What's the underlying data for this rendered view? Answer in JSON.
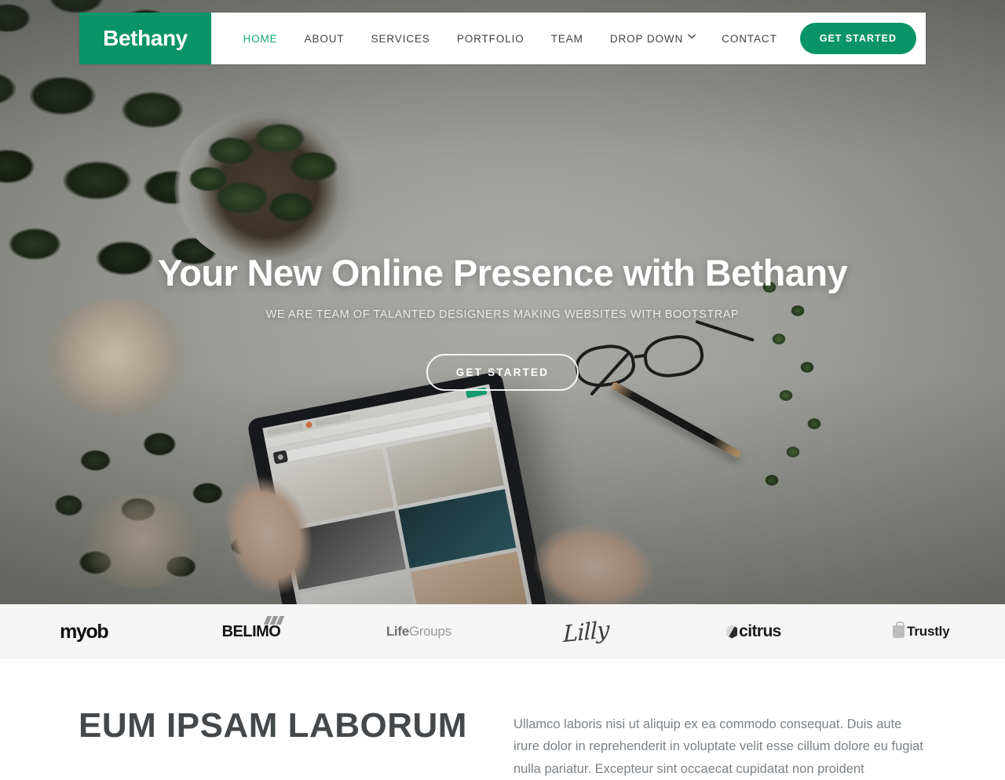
{
  "theme": {
    "accent": "#0a9468",
    "accent_light": "#0fa97a",
    "nav_text": "#3d4348",
    "heading": "#44484b",
    "body_text": "#7b8287",
    "clients_bg": "#f5f5f5"
  },
  "navbar": {
    "brand": "Bethany",
    "links": [
      {
        "label": "HOME",
        "active": true,
        "caret": false
      },
      {
        "label": "ABOUT",
        "active": false,
        "caret": false
      },
      {
        "label": "SERVICES",
        "active": false,
        "caret": false
      },
      {
        "label": "PORTFOLIO",
        "active": false,
        "caret": false
      },
      {
        "label": "TEAM",
        "active": false,
        "caret": false
      },
      {
        "label": "DROP DOWN",
        "active": false,
        "caret": true
      },
      {
        "label": "CONTACT",
        "active": false,
        "caret": false
      }
    ],
    "cta_label": "GET STARTED",
    "caret_icon": "chevron-down-icon"
  },
  "hero": {
    "title": "Your New Online Presence with Bethany",
    "subtitle": "WE ARE TEAM OF TALANTED DESIGNERS MAKING WEBSITES WITH BOOTSTRAP",
    "cta_label": "GET STARTED"
  },
  "clients": [
    {
      "name": "myob",
      "icon": "myob-logo"
    },
    {
      "name": "BELIMO",
      "icon": "belimo-logo"
    },
    {
      "name_bold": "Life",
      "name_rest": "Groups",
      "icon": "lifegroups-logo"
    },
    {
      "name": "Lilly",
      "icon": "lilly-logo"
    },
    {
      "name": "citrus",
      "icon": "citrus-logo"
    },
    {
      "name": "Trustly",
      "icon": "trustly-logo"
    }
  ],
  "about": {
    "title": "EUM IPSAM LABORUM",
    "body": "Ullamco laboris nisi ut aliquip ex ea commodo consequat. Duis aute irure dolor in reprehenderit in voluptate velit esse cillum dolore eu fugiat nulla pariatur. Excepteur sint occaecat cupidatat non proident"
  }
}
